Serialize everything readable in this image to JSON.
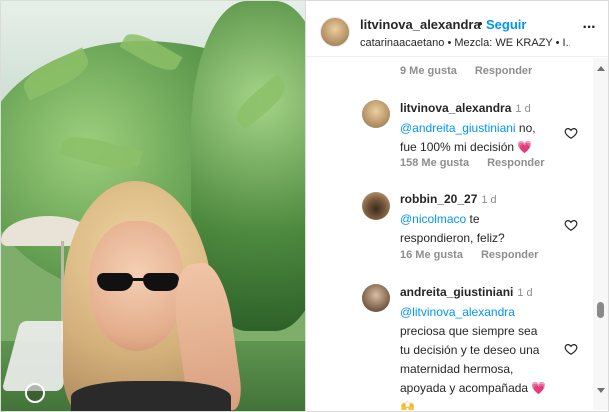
{
  "header": {
    "username": "litvinova_alexandra",
    "separator": "•",
    "follow_label": "Seguir",
    "subtitle": "catarinaacaetano • Mezcla: WE KRAZY • I...",
    "more_label": "···"
  },
  "comments": [
    {
      "partial": true,
      "likes": "9 Me gusta",
      "reply_label": "Responder"
    },
    {
      "username": "litvinova_alexandra",
      "time": "1 d",
      "mention": "@andreita_giustiniani",
      "text": " no, fue 100% mi decisión 💗",
      "likes": "158 Me gusta",
      "reply_label": "Responder"
    },
    {
      "username": "robbin_20_27",
      "time": "1 d",
      "mention": "@nicolmaco",
      "text": " te respondieron, feliz?",
      "likes": "16 Me gusta",
      "reply_label": "Responder"
    },
    {
      "username": "andreita_giustiniani",
      "time": "1 d",
      "mention": "@litvinova_alexandra",
      "text": " preciosa que siempre sea tu decisión y te deseo una maternidad hermosa, apoyada y acompañada 💗 🙌"
    }
  ],
  "icons": {
    "heart": "heart-outline-icon",
    "more": "more-horizontal-icon",
    "mute": "sound-off-icon"
  },
  "colors": {
    "link_blue": "#0095f6",
    "text": "#262626",
    "secondary": "#8e8e8e",
    "border": "#dbdbdb"
  }
}
